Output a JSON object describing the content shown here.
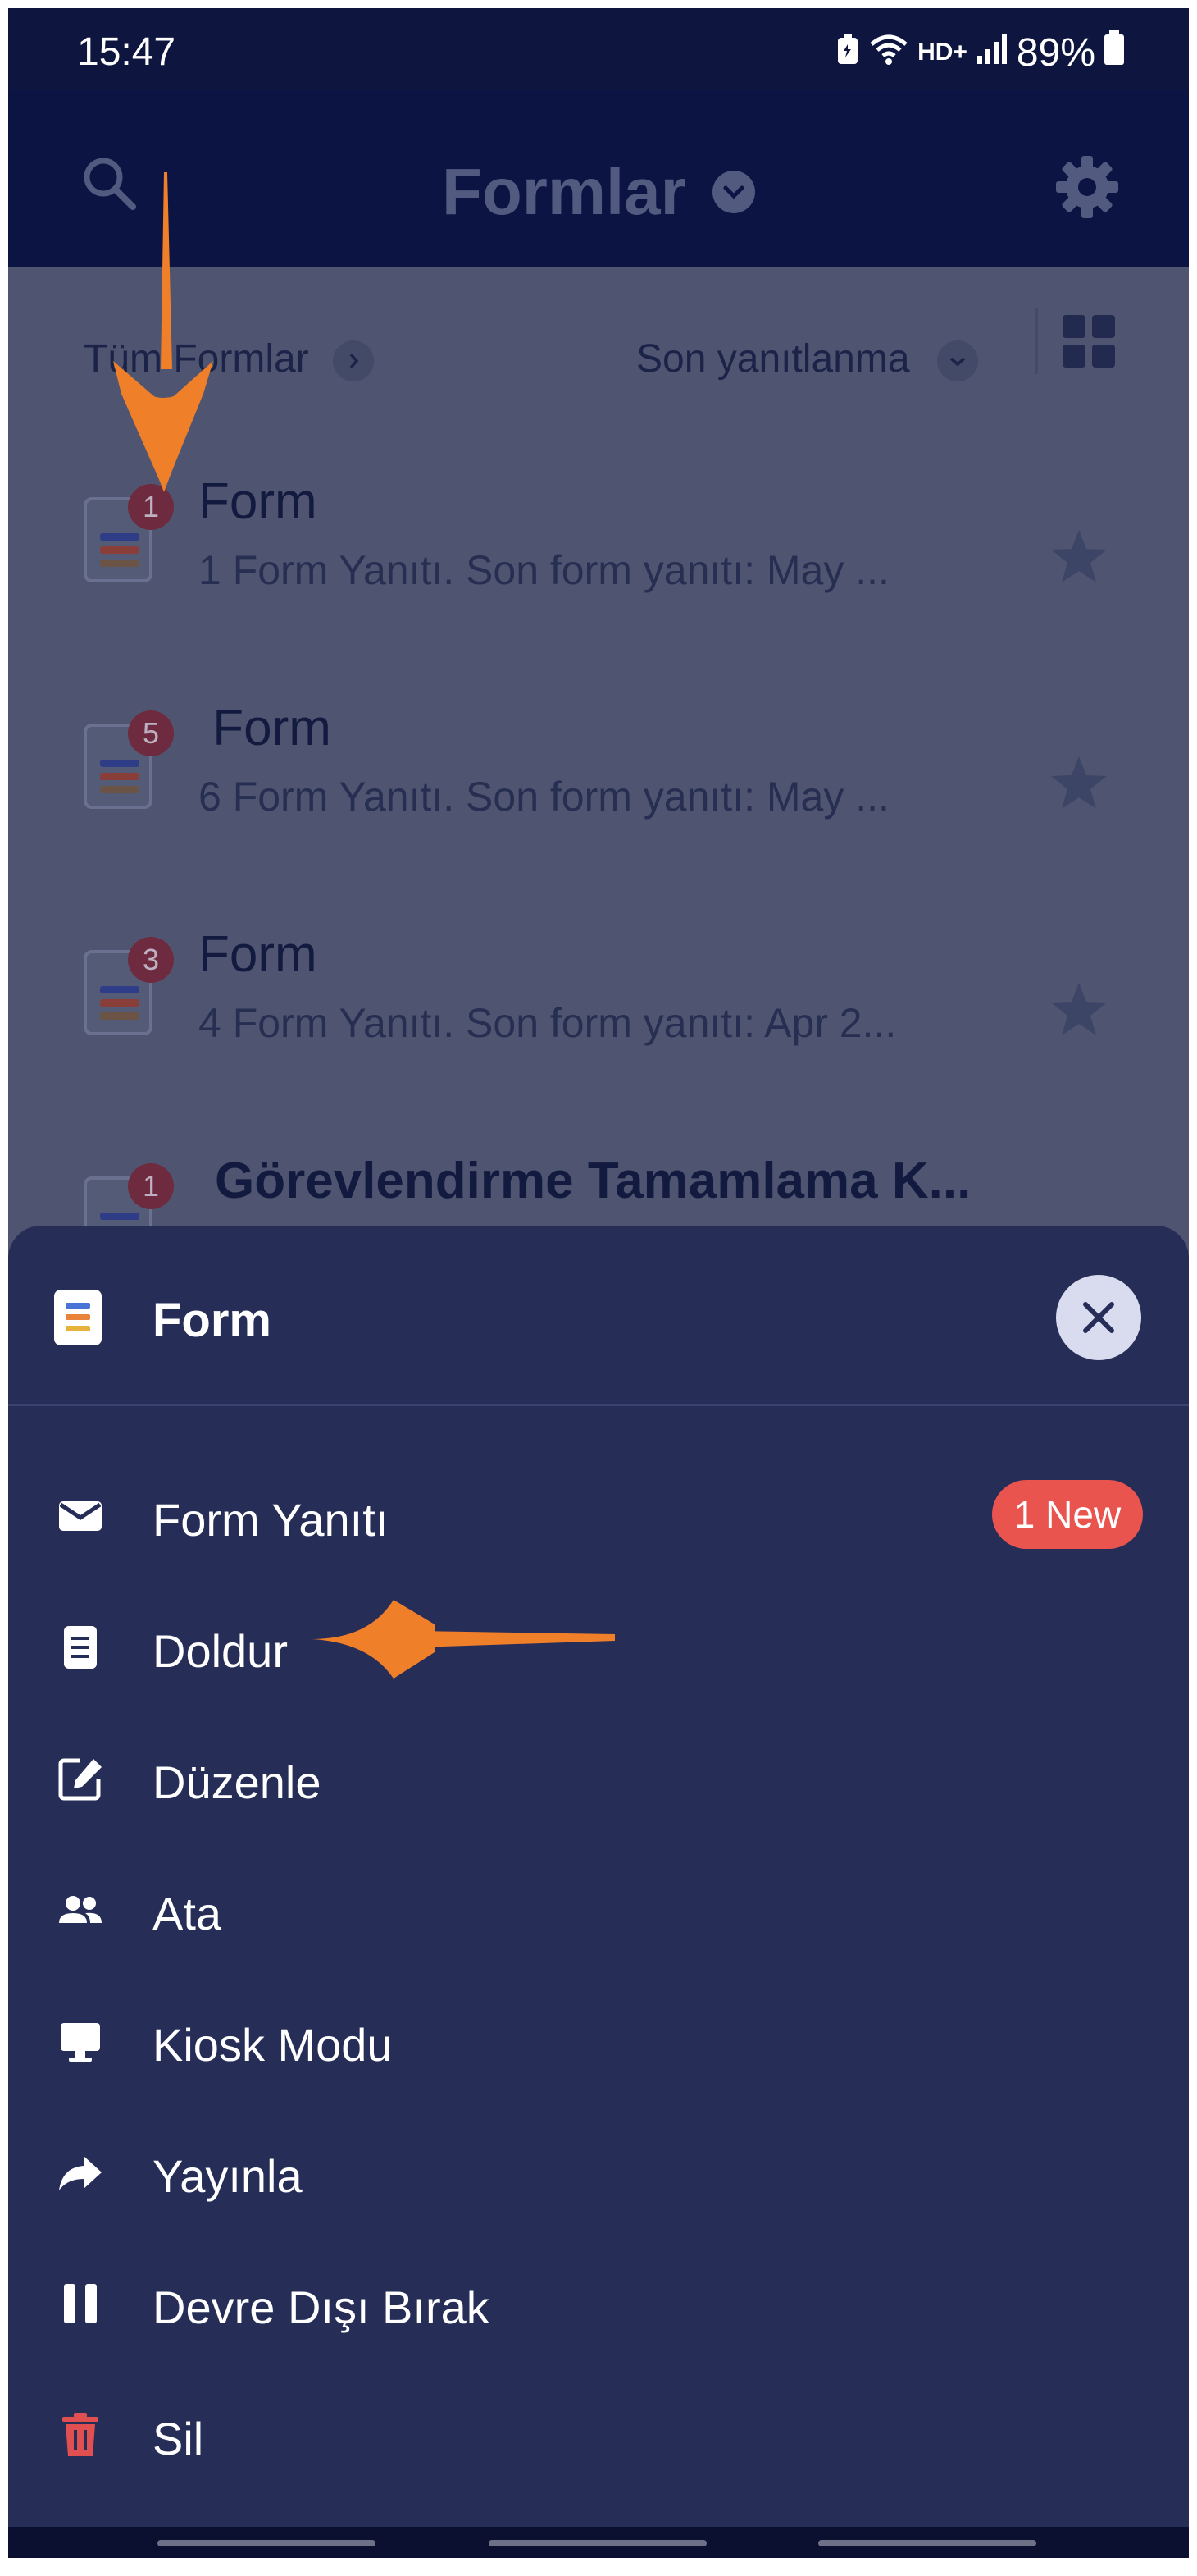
{
  "status_bar": {
    "time": "15:47",
    "network": "HD+",
    "battery": "89%"
  },
  "app_bar": {
    "title": "Formlar",
    "icons": [
      "search-icon",
      "chevron-down-icon",
      "gear-icon"
    ]
  },
  "filters": {
    "folder": "Tüm Formlar",
    "sort": "Son yanıtlanma"
  },
  "forms": [
    {
      "title": "Form",
      "badge": "1",
      "subtitle": "1 Form Yanıtı. Son form yanıtı: May ..."
    },
    {
      "title": " Form",
      "badge": "5",
      "subtitle": "6 Form Yanıtı. Son form yanıtı: May ..."
    },
    {
      "title": "Form",
      "badge": "3",
      "subtitle": "4 Form Yanıtı. Son form yanıtı: Apr 2..."
    },
    {
      "title": "Görevlendirme Tamamlama K...",
      "badge": "1",
      "subtitle": ""
    }
  ],
  "sheet": {
    "title": "Form",
    "items": [
      {
        "label": "Form Yanıtı",
        "icon": "envelope-icon",
        "badge": "1 New"
      },
      {
        "label": "Doldur",
        "icon": "document-icon"
      },
      {
        "label": "Düzenle",
        "icon": "edit-icon"
      },
      {
        "label": "Ata",
        "icon": "people-icon"
      },
      {
        "label": "Kiosk Modu",
        "icon": "monitor-icon"
      },
      {
        "label": "Yayınla",
        "icon": "share-arrow-icon"
      },
      {
        "label": "Devre Dışı Bırak",
        "icon": "pause-icon"
      },
      {
        "label": "Sil",
        "icon": "trash-icon"
      }
    ]
  },
  "colors": {
    "sheet_bg": "#262d57",
    "new_badge": "#e9544f",
    "annotation_arrow": "#f07f2a",
    "trash": "#e05050"
  }
}
